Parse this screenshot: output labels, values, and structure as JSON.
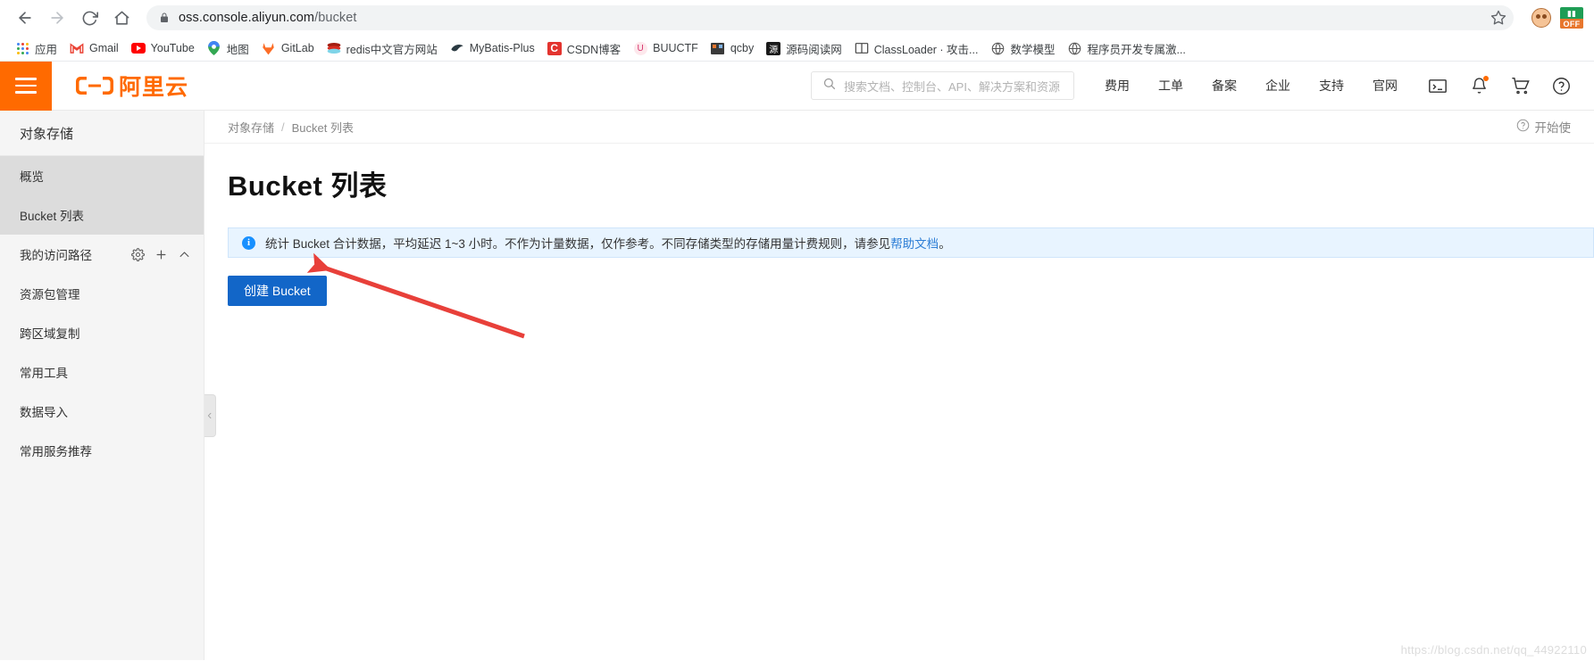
{
  "browser": {
    "url_main": "oss.console.aliyun.com",
    "url_path": "/bucket",
    "back_icon": "back-arrow-icon",
    "forward_icon": "forward-arrow-icon",
    "reload_icon": "reload-icon",
    "home_icon": "home-icon",
    "lock_icon": "lock-icon",
    "star_icon": "bookmark-star-icon",
    "ext_off_label": "OFF"
  },
  "bookmarks": [
    {
      "label": "应用",
      "icon": "apps-grid-icon"
    },
    {
      "label": "Gmail",
      "icon": "gmail-icon"
    },
    {
      "label": "YouTube",
      "icon": "youtube-icon"
    },
    {
      "label": "地图",
      "icon": "google-maps-icon"
    },
    {
      "label": "GitLab",
      "icon": "gitlab-icon"
    },
    {
      "label": "redis中文官方网站",
      "icon": "redis-icon"
    },
    {
      "label": "MyBatis-Plus",
      "icon": "mybatis-icon"
    },
    {
      "label": "CSDN博客",
      "icon": "csdn-icon"
    },
    {
      "label": "BUUCTF",
      "icon": "buuctf-icon"
    },
    {
      "label": "qcby",
      "icon": "qcby-icon"
    },
    {
      "label": "源码阅读网",
      "icon": "source-read-icon"
    },
    {
      "label": "ClassLoader · 攻击...",
      "icon": "classloader-icon"
    },
    {
      "label": "数学模型",
      "icon": "globe-icon"
    },
    {
      "label": "程序员开发专属激...",
      "icon": "globe-icon"
    }
  ],
  "header": {
    "menu_icon": "hamburger-menu-icon",
    "logo_text": "阿里云",
    "search_placeholder": "搜索文档、控制台、API、解决方案和资源",
    "search_icon": "search-icon",
    "nav": [
      {
        "label": "费用"
      },
      {
        "label": "工单"
      },
      {
        "label": "备案"
      },
      {
        "label": "企业"
      },
      {
        "label": "支持"
      },
      {
        "label": "官网"
      }
    ],
    "icons": [
      {
        "name": "terminal-icon"
      },
      {
        "name": "bell-notification-icon"
      },
      {
        "name": "shopping-cart-icon"
      },
      {
        "name": "help-circle-icon"
      }
    ]
  },
  "sidebar": {
    "title": "对象存储",
    "items": [
      {
        "label": "概览",
        "active": true
      },
      {
        "label": "Bucket 列表",
        "active": true
      },
      {
        "label": "我的访问路径",
        "has_actions": true
      },
      {
        "label": "资源包管理"
      },
      {
        "label": "跨区域复制"
      },
      {
        "label": "常用工具"
      },
      {
        "label": "数据导入"
      },
      {
        "label": "常用服务推荐"
      }
    ],
    "action_icons": {
      "settings": "gear-icon",
      "add": "plus-icon",
      "collapse": "chevron-up-icon"
    },
    "collapse_handle_icon": "chevron-left-icon"
  },
  "main": {
    "breadcrumb": {
      "root": "对象存储",
      "separator": "/",
      "current": "Bucket 列表"
    },
    "start_guide": {
      "icon": "question-circle-icon",
      "label": "开始使"
    },
    "page_title": "Bucket 列表",
    "alert": {
      "icon": "info-icon",
      "text_before": "统计 Bucket 合计数据，平均延迟 1~3 小时。不作为计量数据，仅作参考。不同存储类型的存储用量计费规则，请参见",
      "link_text": "帮助文档",
      "text_after": "。"
    },
    "create_button": "创建 Bucket",
    "watermark": "https://blog.csdn.net/qq_44922110"
  }
}
